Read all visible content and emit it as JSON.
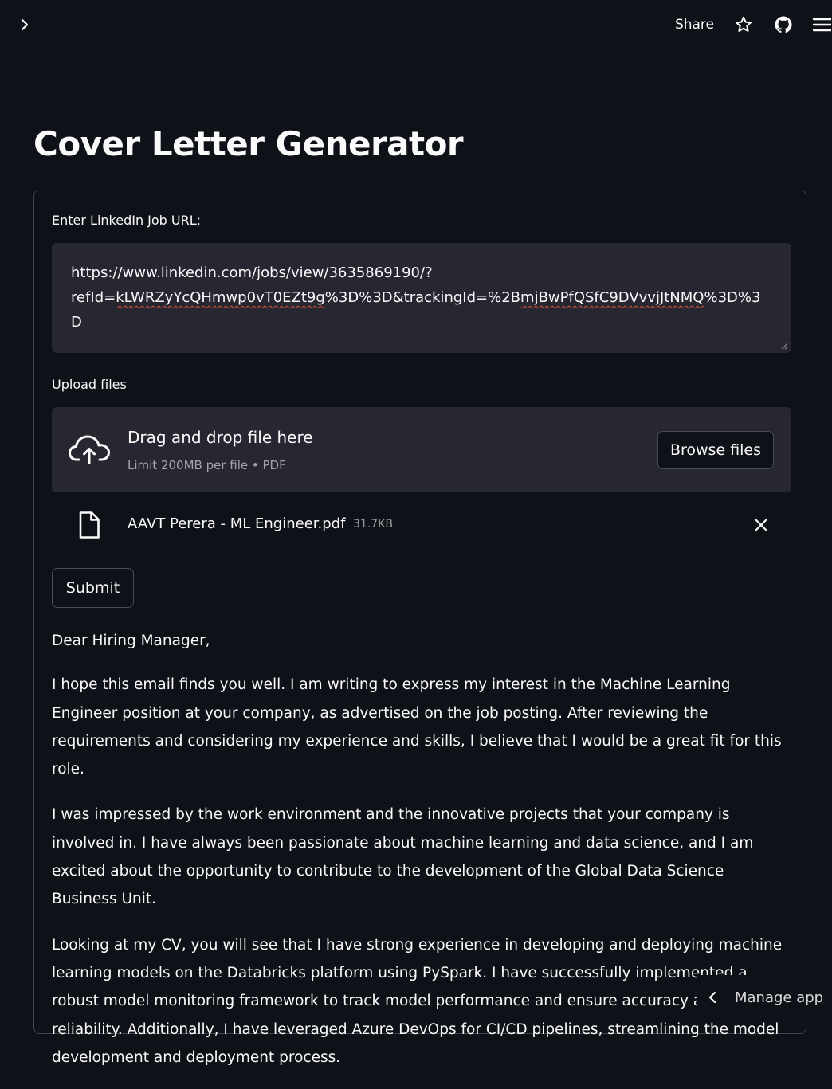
{
  "header": {
    "sidebar_toggle_icon": "chevron-right-icon",
    "share_label": "Share",
    "icons": [
      "star-icon",
      "github-icon",
      "hamburger-menu-icon"
    ]
  },
  "page": {
    "title": "Cover Letter Generator"
  },
  "form": {
    "url_label": "Enter LinkedIn Job URL:",
    "url_value": {
      "line1": "https://www.linkedin.com/jobs/view/3635869190/?",
      "line2_a": "refId=",
      "line2_b": "kLWRZyYcQHmwp0vT0EZt9g",
      "line2_c": "%3D%3D&trackingId=%2B",
      "line2_d": "mjBwPfQSfC9DVvvjJtNMQ",
      "line2_e": "%3D%3",
      "line3": "D"
    },
    "upload_label": "Upload files",
    "dropzone": {
      "title": "Drag and drop file here",
      "hint": "Limit 200MB per file • PDF",
      "browse_label": "Browse files",
      "icon": "cloud-upload-icon"
    },
    "uploaded_file": {
      "name": "AAVT Perera - ML Engineer.pdf",
      "size": "31.7KB",
      "icon": "file-icon"
    },
    "submit_label": "Submit"
  },
  "letter": {
    "salutation": "Dear Hiring Manager,",
    "paragraphs": [
      "I hope this email finds you well. I am writing to express my interest in the Machine Learning Engineer position at your company, as advertised on the job posting. After reviewing the requirements and considering my experience and skills, I believe that I would be a great fit for this role.",
      "I was impressed by the work environment and the innovative projects that your company is involved in. I have always been passionate about machine learning and data science, and I am excited about the opportunity to contribute to the development of the Global Data Science Business Unit.",
      "Looking at my CV, you will see that I have strong experience in developing and deploying machine learning models on the Databricks platform using PySpark. I have successfully implemented a robust model monitoring framework to track model performance and ensure accuracy and reliability. Additionally, I have leveraged Azure DevOps for CI/CD pipelines, streamlining the model development and deployment process."
    ]
  },
  "footer": {
    "manage_app_label": "Manage app"
  },
  "colors": {
    "background": "#0e1117",
    "input_background": "#262730",
    "text": "#fafafa"
  }
}
